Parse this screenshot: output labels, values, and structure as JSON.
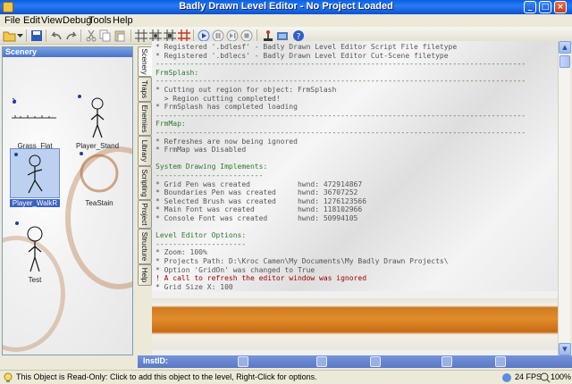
{
  "window": {
    "title": "Badly Drawn Level Editor - No Project Loaded"
  },
  "menu": [
    "File",
    "Edit",
    "View",
    "Debug",
    "Tools",
    "Help"
  ],
  "scenery_panel": {
    "title": "Scenery",
    "items": [
      {
        "label": "Grass_Flat",
        "icon": "grass-sprite"
      },
      {
        "label": "Player_Stand",
        "icon": "stickman-sprite"
      },
      {
        "label": "Player_WalkR",
        "icon": "stickman-sprite",
        "selected": true
      },
      {
        "label": "TeaStain",
        "icon": "tea-stain-sprite"
      },
      {
        "label": "Test",
        "icon": "stickman-sprite"
      }
    ]
  },
  "side_tabs": [
    "Scenery",
    "Traps",
    "Enemies",
    "Library",
    "Scripting",
    "Project",
    "Structure",
    "Help"
  ],
  "console": {
    "lines": [
      {
        "t": "* Registered '.bdlesf' - Badly Drawn Level Editor Script File filetype",
        "k": "n"
      },
      {
        "t": "* Registered '.bdlecs' - Badly Drawn Level Editor Cut-Scene filetype",
        "k": "n"
      },
      {
        "t": "--------------------------------------------------------------------------------------",
        "k": "g"
      },
      {
        "t": "FrmSplash:",
        "k": "g"
      },
      {
        "t": "--------------------------------------------------------------------------------------",
        "k": "g"
      },
      {
        "t": "* Cutting out region for object: FrmSplash",
        "k": "n"
      },
      {
        "t": "  > Region cutting completed!",
        "k": "n"
      },
      {
        "t": "* FrmSplash has completed loading",
        "k": "n"
      },
      {
        "t": "--------------------------------------------------------------------------------------",
        "k": "g"
      },
      {
        "t": "FrmMap:",
        "k": "g"
      },
      {
        "t": "--------------------------------------------------------------------------------------",
        "k": "g"
      },
      {
        "t": "* Refreshes are now being ignored",
        "k": "n"
      },
      {
        "t": "* FrmMap was Disabled",
        "k": "n"
      },
      {
        "t": "",
        "k": "n"
      },
      {
        "t": "System Drawing Implements:",
        "k": "g"
      },
      {
        "t": "-------------------------",
        "k": "g"
      },
      {
        "t": "* Grid Pen was created           hwnd: 472914867",
        "k": "n"
      },
      {
        "t": "* Boundaries Pen was created     hwnd: 36707252",
        "k": "n"
      },
      {
        "t": "* Selected Brush was created     hwnd: 1276123566",
        "k": "n"
      },
      {
        "t": "* Main Font was created          hwnd: 118102966",
        "k": "n"
      },
      {
        "t": "* Console Font was created       hwnd: 50994105",
        "k": "n"
      },
      {
        "t": "",
        "k": "n"
      },
      {
        "t": "Level Editor Options:",
        "k": "g"
      },
      {
        "t": "---------------------",
        "k": "g"
      },
      {
        "t": "* Zoom: 100%",
        "k": "n"
      },
      {
        "t": "* Projects Path: D:\\Kroc Camen\\My Documents\\My Badly Drawn Projects\\",
        "k": "n"
      },
      {
        "t": "* Option 'GridOn' was changed to True",
        "k": "n"
      },
      {
        "t": "! A call to refresh the editor window was ignored",
        "k": "e"
      },
      {
        "t": "* Grid Size X: 100",
        "k": "n"
      }
    ]
  },
  "instance_bar": {
    "label": "InstID:"
  },
  "status": {
    "message": "This Object is Read-Only: Click to add this object to the level, Right-Click for options.",
    "fps": "24 FPS",
    "zoom": "100%"
  },
  "colors": {
    "title_bar": "#0a5fe0",
    "console_green": "#2f7a2f",
    "console_error": "#a10000",
    "ground_orange": "#d97f22"
  }
}
